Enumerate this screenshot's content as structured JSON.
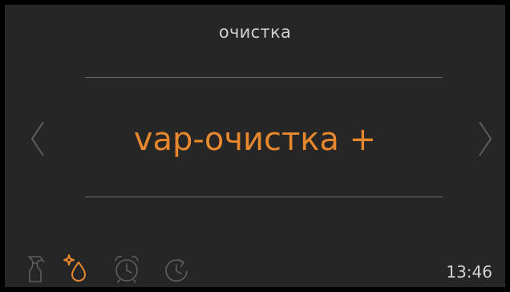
{
  "screen": {
    "title": "очистка",
    "selected_program": "vap-очистка +",
    "time": "13:46"
  },
  "navigation": {
    "prev_icon": "chevron-left-icon",
    "next_icon": "chevron-right-icon"
  },
  "bottom_icons": [
    {
      "icon": "spray-bottle-icon",
      "active": false
    },
    {
      "icon": "sparkle-drop-icon",
      "active": true
    },
    {
      "icon": "alarm-clock-icon",
      "active": false
    },
    {
      "icon": "timer-clock-icon",
      "active": false
    }
  ],
  "colors": {
    "background": "#262626",
    "accent": "#e7872e",
    "text": "#d2d2d2",
    "inactive_icon": "#5e5e5e",
    "divider": "#6a6a6a"
  }
}
